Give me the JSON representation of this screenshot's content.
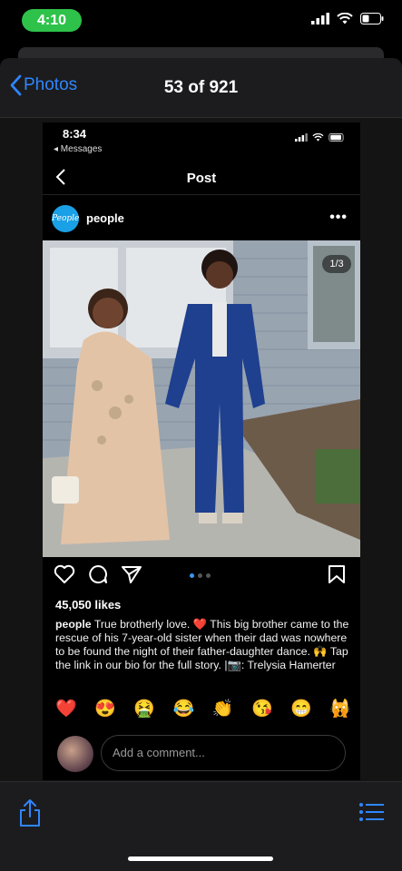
{
  "status_bar": {
    "time": "4:10"
  },
  "nav": {
    "back_label": "Photos",
    "title": "53 of 921"
  },
  "instagram": {
    "status_time": "8:34",
    "back_app": "◂ Messages",
    "header_title": "Post",
    "account": "people",
    "avatar_text": "People",
    "image_counter": "1/3",
    "likes": "45,050 likes",
    "caption_user": "people",
    "caption_text": "True brotherly love. ❤️ This big brother came to the rescue of his 7-year-old sister when their dad was nowhere to be found the night of their father-daughter dance. 🙌 Tap the link in our bio for the full story. |📷: Trelysia Hamerter",
    "quick_reactions": [
      "❤️",
      "😍",
      "🤮",
      "😂",
      "👏",
      "😘",
      "😁",
      "🙀"
    ],
    "comment_placeholder": "Add a comment..."
  },
  "colors": {
    "accent": "#2f86ff",
    "status_pill": "#2ec24a",
    "instagram_blue": "#3897f0"
  },
  "icons": [
    "wifi-icon",
    "battery-icon",
    "signal-icon",
    "share-icon",
    "list-icon",
    "heart-icon",
    "comment-icon",
    "send-icon",
    "bookmark-icon"
  ]
}
